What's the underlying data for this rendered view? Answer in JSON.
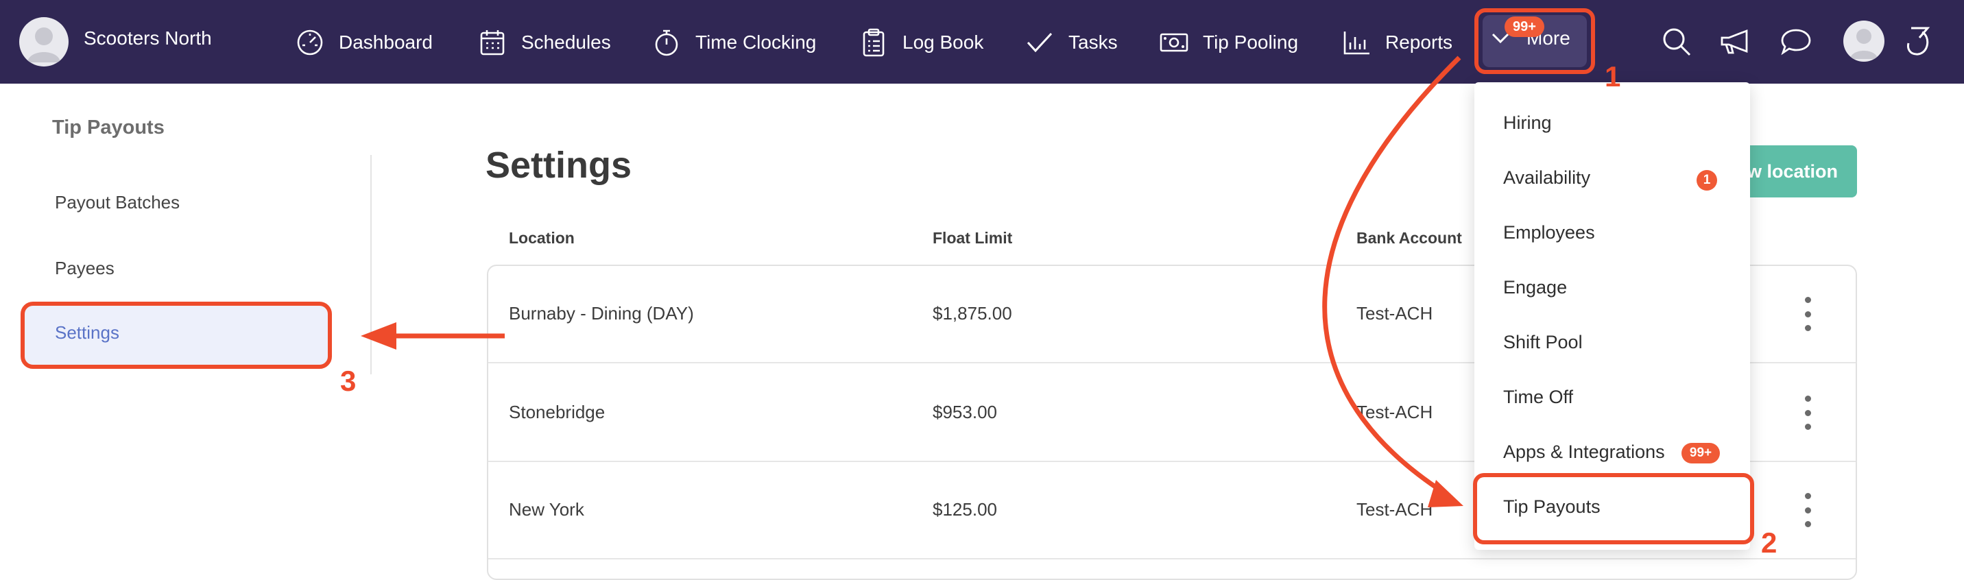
{
  "topbar": {
    "org_name": "Scooters North",
    "nav": [
      {
        "label": "Dashboard",
        "icon": "dashboard-gauge-icon"
      },
      {
        "label": "Schedules",
        "icon": "calendar-icon"
      },
      {
        "label": "Time Clocking",
        "icon": "stopwatch-icon"
      },
      {
        "label": "Log Book",
        "icon": "clipboard-icon"
      },
      {
        "label": "Tasks",
        "icon": "checkmark-icon"
      },
      {
        "label": "Tip Pooling",
        "icon": "cash-icon"
      },
      {
        "label": "Reports",
        "icon": "bar-chart-icon"
      }
    ],
    "more_label": "More",
    "more_badge": "99+",
    "right_icons": [
      "search-icon",
      "megaphone-icon",
      "chat-icon",
      "user-avatar",
      "brand-logo-icon"
    ]
  },
  "sidebar": {
    "title": "Tip Payouts",
    "items": [
      {
        "label": "Payout Batches"
      },
      {
        "label": "Payees"
      },
      {
        "label": "Settings",
        "active": true
      }
    ]
  },
  "main": {
    "title": "Settings",
    "new_location_button": "ew location",
    "columns": [
      "Location",
      "Float Limit",
      "Bank Account"
    ],
    "rows": [
      {
        "location": "Burnaby - Dining (DAY)",
        "float_limit": "$1,875.00",
        "bank_account": "Test-ACH"
      },
      {
        "location": "Stonebridge",
        "float_limit": "$953.00",
        "bank_account": "Test-ACH"
      },
      {
        "location": "New York",
        "float_limit": "$125.00",
        "bank_account": "Test-ACH"
      }
    ]
  },
  "dropdown": {
    "items": [
      {
        "label": "Hiring"
      },
      {
        "label": "Availability",
        "badge": "1"
      },
      {
        "label": "Employees"
      },
      {
        "label": "Engage"
      },
      {
        "label": "Shift Pool"
      },
      {
        "label": "Time Off"
      },
      {
        "label": "Apps & Integrations",
        "badge": "99+"
      },
      {
        "label": "Tip Payouts"
      }
    ]
  },
  "annotations": {
    "step1": "1",
    "step2": "2",
    "step3": "3",
    "color": "#ee4b2b"
  },
  "colors": {
    "nav_bg": "#302754",
    "accent_badge": "#f05a36",
    "button_green": "#5ebea7",
    "active_link": "#5a73c7"
  }
}
